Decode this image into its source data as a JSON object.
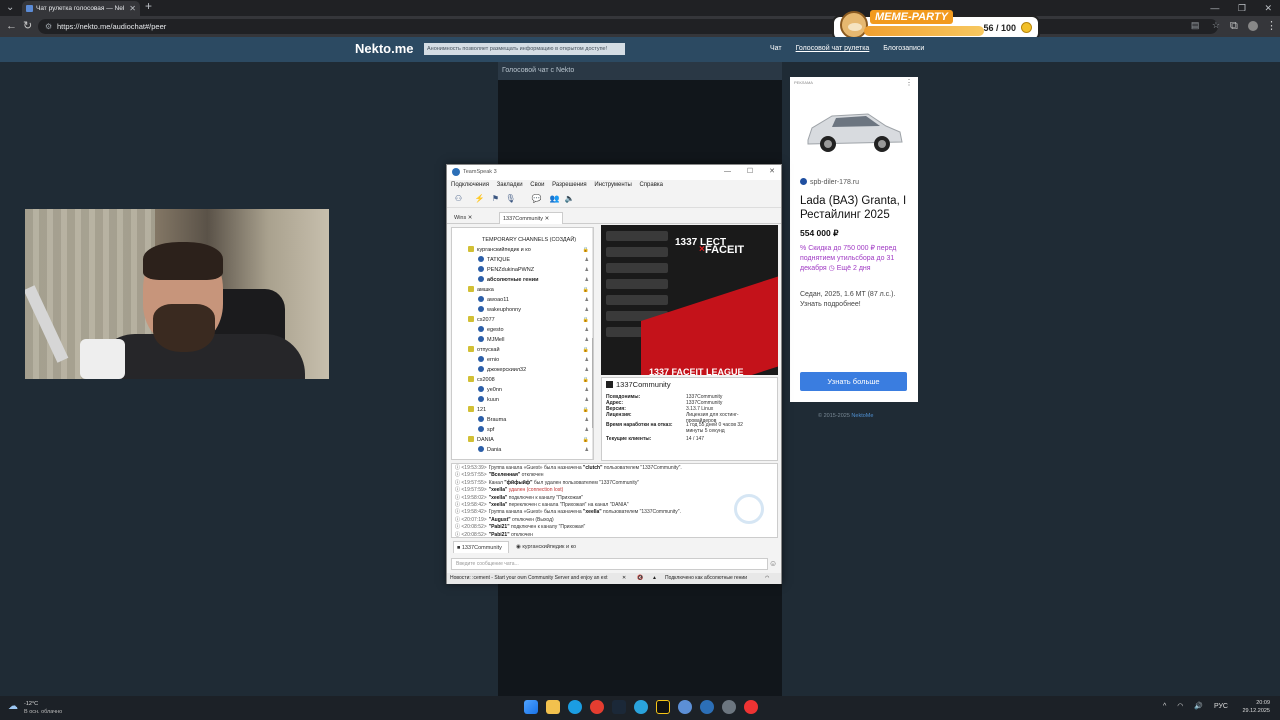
{
  "browser": {
    "tab_title": "Чат рулетка голосовая — Nekto",
    "url": "https://nekto.me/audiochat#/peer",
    "new_tab": "+"
  },
  "overlay": {
    "title": "MEME-PARTY",
    "score": "56 / 100"
  },
  "site": {
    "logo": "Nekto.me",
    "note": "Анонимность позволяет размещать информацию в открытом доступе!",
    "nav": [
      "Чат",
      "Голосовой чат рулетка",
      "Блогозаписи"
    ],
    "chat_header": "Голосовой чат с Nekto",
    "footer_copy": "© 2015-2025",
    "footer_link": "NektoMe"
  },
  "ad": {
    "label": "РЕКЛАМА",
    "source": "spb-diler-178.ru",
    "headline": "Lada (ВАЗ) Granta, I Рестайлинг 2025",
    "price": "554 000 ₽",
    "promo": "Скидка до 750 000 ₽ перед поднятием утильсбора до 31 декабря",
    "promo_days": "Ещё 2 дня",
    "desc": "Седан, 2025, 1.6 MT (87 л.с.). Узнать подробнее!",
    "cta": "Узнать больше"
  },
  "teamspeak": {
    "window_title": "TeamSpeak 3",
    "menu": [
      "Подключения",
      "Закладки",
      "Свои",
      "Разрешения",
      "Инструменты",
      "Справка"
    ],
    "tabs": [
      "Wins",
      "1337Community"
    ],
    "tree_header": "TEMPORARY CHANNELS (СОЗДАЙ)",
    "tree": [
      {
        "type": "ch",
        "name": "курганскийпедик и ко"
      },
      {
        "type": "usr",
        "name": "TATIQUE"
      },
      {
        "type": "usr",
        "name": "PENZdukinaPWNZ"
      },
      {
        "type": "usr",
        "name": "абсолютные гении",
        "bold": true
      },
      {
        "type": "ch",
        "name": "амшка"
      },
      {
        "type": "usr",
        "name": "awoao11"
      },
      {
        "type": "usr",
        "name": "wakeuphonny"
      },
      {
        "type": "ch",
        "name": "cs2077"
      },
      {
        "type": "usr",
        "name": "egesto"
      },
      {
        "type": "usr",
        "name": "MJMell"
      },
      {
        "type": "ch",
        "name": "отпускай"
      },
      {
        "type": "usr",
        "name": "ernio"
      },
      {
        "type": "usr",
        "name": "джокерскиил32"
      },
      {
        "type": "ch",
        "name": "cs2008"
      },
      {
        "type": "usr",
        "name": "ye0nn"
      },
      {
        "type": "usr",
        "name": "kuun"
      },
      {
        "type": "ch",
        "name": "121"
      },
      {
        "type": "usr",
        "name": "Brauma"
      },
      {
        "type": "usr",
        "name": "spf"
      },
      {
        "type": "ch",
        "name": "DANIA"
      },
      {
        "type": "usr",
        "name": "Dania"
      }
    ],
    "banner": {
      "brand": "1337 LECT",
      "x": "×",
      "brand2": "FACEIT",
      "league": "1337 FACEIT LEAGUE"
    },
    "server_name": "1337Community",
    "info": [
      {
        "k": "Псевдонимы:",
        "v": "1337Community"
      },
      {
        "k": "Адрес:",
        "v": "1337Community"
      },
      {
        "k": "Версия:",
        "v": "3.13.7 Linux"
      },
      {
        "k": "Лицензия:",
        "v": "Лицензия для хостинг-провайдеров"
      },
      {
        "k": "Время наработки на отказ:",
        "v": "1 год 55 дней 0 часов 32 минуты 5 секунд"
      },
      {
        "k": "Текущие клиенты:",
        "v": "14 / 147"
      }
    ],
    "log": [
      {
        "time": "<19:53:39>",
        "pre": "Группа канала «Guest» была назначена ",
        "nm": "\"clutch\"",
        "post": " пользователем \"1337Community\"."
      },
      {
        "time": "<19:57:55>",
        "pre": "",
        "nm": "\"Вселенная\"",
        "post": " отключен"
      },
      {
        "time": "<19:57:55>",
        "pre": "Канал ",
        "nm": "\"фйфыйф\"",
        "post": " был удален пользователем \"1337Community\""
      },
      {
        "time": "<19:57:59>",
        "pre": "",
        "nm": "\"xeella\"",
        "post": " удален (connection lost)",
        "err": true
      },
      {
        "time": "<19:58:02>",
        "pre": "",
        "nm": "\"xeella\"",
        "post": " подключен к каналу \"Прихожая\""
      },
      {
        "time": "<19:58:42>",
        "pre": "",
        "nm": "\"xeella\"",
        "post": " переключен с канала \"Прихожая\" на канал \"DANIA\""
      },
      {
        "time": "<19:58:42>",
        "pre": "Группа канала «Guest» была назначена ",
        "nm": "\"xeella\"",
        "post": " пользователем \"1337Community\"."
      },
      {
        "time": "<20:07:19>",
        "pre": "",
        "nm": "\"August\"",
        "post": " отключен (Выход)"
      },
      {
        "time": "<20:08:52>",
        "pre": "",
        "nm": "\"Pabi21\"",
        "post": " подключен к каналу \"Прихожая\""
      },
      {
        "time": "<20:08:52>",
        "pre": "",
        "nm": "\"Pabi21\"",
        "post": " отключен"
      }
    ],
    "bottom_tabs": [
      "1337Community",
      "курганскийпедик и ко"
    ],
    "input_placeholder": "Введите сообщение чата...",
    "news": "Новости: :cement - Start your own Community Server and enjoy an ext",
    "status": "Подключено как абсолютные гении"
  },
  "taskbar": {
    "temp": "-12°C",
    "weather": "В осн. облачно",
    "lang": "РУС",
    "time": "20:09",
    "date": "29.12.2025"
  }
}
